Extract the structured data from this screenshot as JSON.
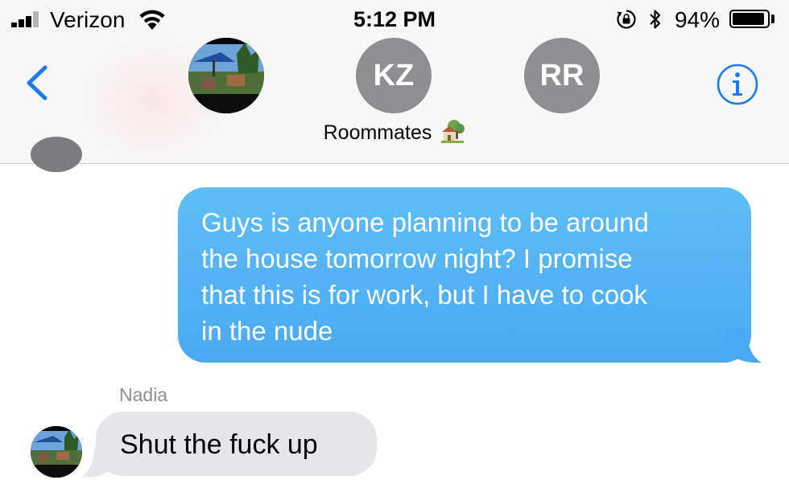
{
  "status_bar": {
    "carrier": "Verizon",
    "time": "5:12 PM",
    "battery_percent": "94%",
    "battery_level": 0.94
  },
  "header": {
    "group_name": "Roommates",
    "participants": [
      {
        "initials": "KZ"
      },
      {
        "initials": "RR"
      }
    ]
  },
  "messages": {
    "outgoing": {
      "lines": [
        "Guys is anyone planning to be around",
        "the house tomorrow night? I promise",
        "that this is for work, but I have to cook",
        "in the nude"
      ]
    },
    "incoming": {
      "sender": "Nadia",
      "text": "Shut the fuck up"
    }
  },
  "colors": {
    "accent_blue": "#1a7cf5",
    "outgoing_bubble": "#4fb0f5",
    "incoming_bubble": "#e5e5ea",
    "avatar_gray": "#8e8e93"
  },
  "icons": {
    "back": "chevron-left-icon",
    "info": "info-icon",
    "wifi": "wifi-icon",
    "bluetooth": "bluetooth-icon",
    "rotation_lock": "rotation-lock-icon",
    "house": "house-with-garden-icon"
  }
}
